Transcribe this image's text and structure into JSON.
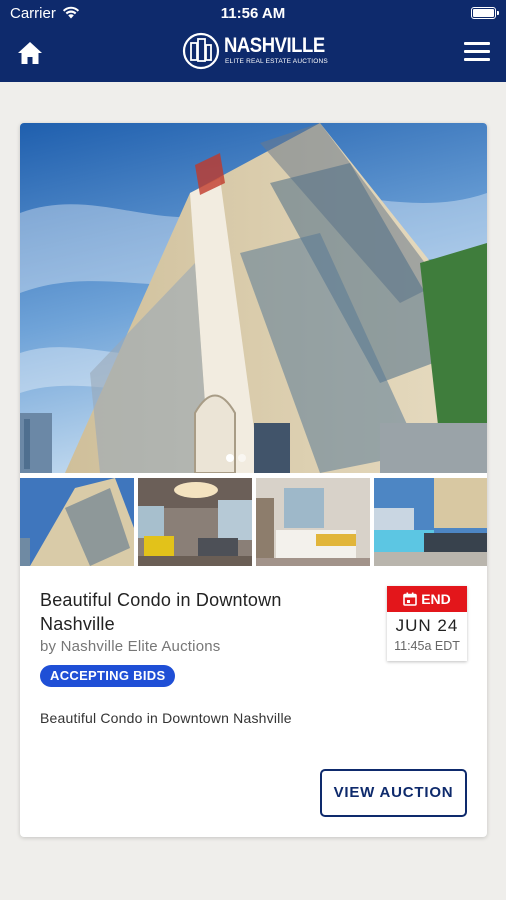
{
  "status_bar": {
    "carrier": "Carrier",
    "time": "11:56 AM"
  },
  "navbar": {
    "logo_word": "NASHVILLE",
    "logo_subtitle": "ELITE REAL ESTATE AUCTIONS",
    "bg_color": "#0e2a6c",
    "left_icon": "home-icon",
    "right_icon": "hamburger-menu-icon"
  },
  "listing": {
    "title": "Beautiful Condo in Downtown Nashville",
    "byline": "by Nashville Elite Auctions",
    "status_badge": "ACCEPTING BIDS",
    "description": "Beautiful Condo in Downtown Nashville",
    "end_label": "END",
    "end_date": "JUN 24",
    "end_time": "11:45a EDT",
    "cta": "VIEW AUCTION",
    "badge_color": "#1f4fd6",
    "end_color": "#e3161b",
    "carousel": {
      "slides": 2,
      "active": 1
    }
  }
}
